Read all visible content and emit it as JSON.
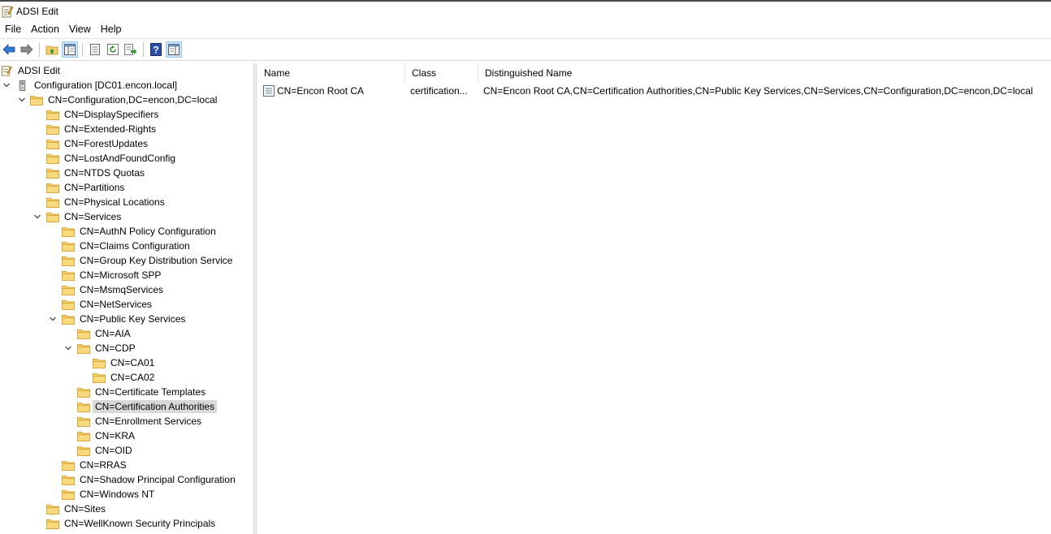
{
  "window": {
    "title": "ADSI Edit"
  },
  "menu": [
    "File",
    "Action",
    "View",
    "Help"
  ],
  "toolbar": {
    "buttons": [
      "back-icon",
      "forward-icon",
      "up-folder-icon",
      "show-hide-tree-icon",
      "properties-icon",
      "refresh-icon",
      "export-list-icon",
      "help-icon",
      "show-action-pane-icon"
    ]
  },
  "tree": {
    "items": [
      {
        "label": "ADSI Edit",
        "icon": "adsi-edit-icon"
      },
      {
        "label": "Configuration [DC01.encon.local]",
        "icon": "server-icon",
        "expanded": true
      },
      {
        "label": "CN=Configuration,DC=encon,DC=local",
        "icon": "folder-icon",
        "expanded": true
      },
      {
        "label": "CN=DisplaySpecifiers",
        "icon": "folder-icon"
      },
      {
        "label": "CN=Extended-Rights",
        "icon": "folder-icon"
      },
      {
        "label": "CN=ForestUpdates",
        "icon": "folder-icon"
      },
      {
        "label": "CN=LostAndFoundConfig",
        "icon": "folder-icon"
      },
      {
        "label": "CN=NTDS Quotas",
        "icon": "folder-icon"
      },
      {
        "label": "CN=Partitions",
        "icon": "folder-icon"
      },
      {
        "label": "CN=Physical Locations",
        "icon": "folder-icon"
      },
      {
        "label": "CN=Services",
        "icon": "folder-icon",
        "expanded": true
      },
      {
        "label": "CN=AuthN Policy Configuration",
        "icon": "folder-icon"
      },
      {
        "label": "CN=Claims Configuration",
        "icon": "folder-icon"
      },
      {
        "label": "CN=Group Key Distribution Service",
        "icon": "folder-icon"
      },
      {
        "label": "CN=Microsoft SPP",
        "icon": "folder-icon"
      },
      {
        "label": "CN=MsmqServices",
        "icon": "folder-icon"
      },
      {
        "label": "CN=NetServices",
        "icon": "folder-icon"
      },
      {
        "label": "CN=Public Key Services",
        "icon": "folder-icon",
        "expanded": true
      },
      {
        "label": "CN=AIA",
        "icon": "folder-icon"
      },
      {
        "label": "CN=CDP",
        "icon": "folder-icon",
        "expanded": true
      },
      {
        "label": "CN=CA01",
        "icon": "folder-icon"
      },
      {
        "label": "CN=CA02",
        "icon": "folder-icon"
      },
      {
        "label": "CN=Certificate Templates",
        "icon": "folder-icon"
      },
      {
        "label": "CN=Certification Authorities",
        "icon": "folder-icon",
        "selected": true
      },
      {
        "label": "CN=Enrollment Services",
        "icon": "folder-icon"
      },
      {
        "label": "CN=KRA",
        "icon": "folder-icon"
      },
      {
        "label": "CN=OID",
        "icon": "folder-icon"
      },
      {
        "label": "CN=RRAS",
        "icon": "folder-icon"
      },
      {
        "label": "CN=Shadow Principal Configuration",
        "icon": "folder-icon"
      },
      {
        "label": "CN=Windows NT",
        "icon": "folder-icon"
      },
      {
        "label": "CN=Sites",
        "icon": "folder-icon"
      },
      {
        "label": "CN=WellKnown Security Principals",
        "icon": "folder-icon"
      }
    ]
  },
  "list": {
    "columns": [
      "Name",
      "Class",
      "Distinguished Name"
    ],
    "rows": [
      {
        "name": "CN=Encon Root CA",
        "class": "certification...",
        "dn": "CN=Encon Root CA,CN=Certification Authorities,CN=Public Key Services,CN=Services,CN=Configuration,DC=encon,DC=local",
        "icon": "object-icon"
      }
    ]
  },
  "colors": {
    "selection": "#d9d9d9",
    "folder": "#f5cf6b",
    "folder_edge": "#d8a93a",
    "pressed": "#cce4f7"
  }
}
